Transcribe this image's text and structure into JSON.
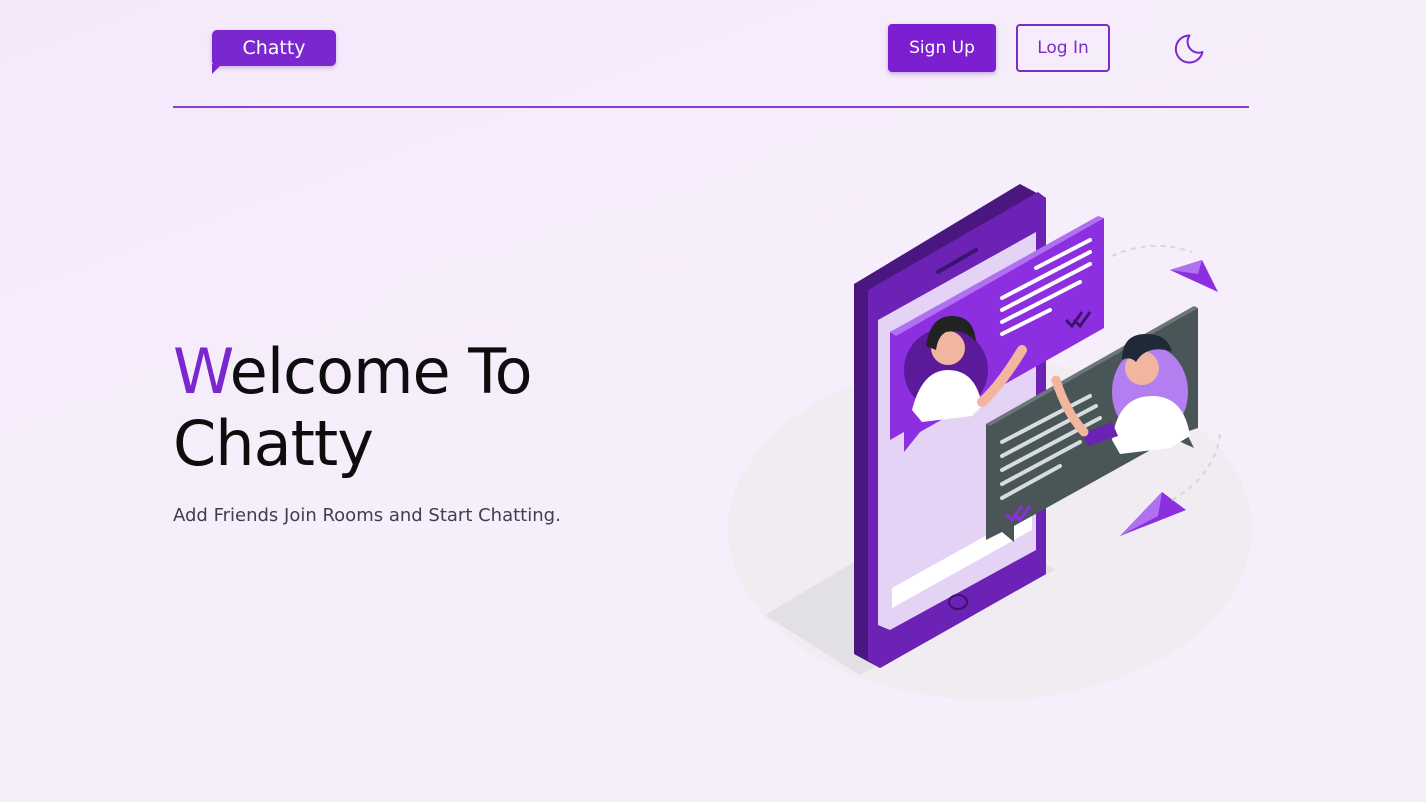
{
  "header": {
    "logo_text": "Chatty",
    "signup_label": "Sign Up",
    "login_label": "Log In",
    "theme_toggle_icon": "moon-icon"
  },
  "hero": {
    "title_first_letter": "W",
    "title_rest_line1": "elcome To",
    "title_line2": "Chatty",
    "subtitle": "Add Friends Join Rooms and Start Chatting."
  },
  "illustration": {
    "name": "phone-chat-illustration"
  },
  "colors": {
    "accent": "#7b27cf",
    "background": "#f6edfb",
    "divider": "#8a3fc8"
  }
}
